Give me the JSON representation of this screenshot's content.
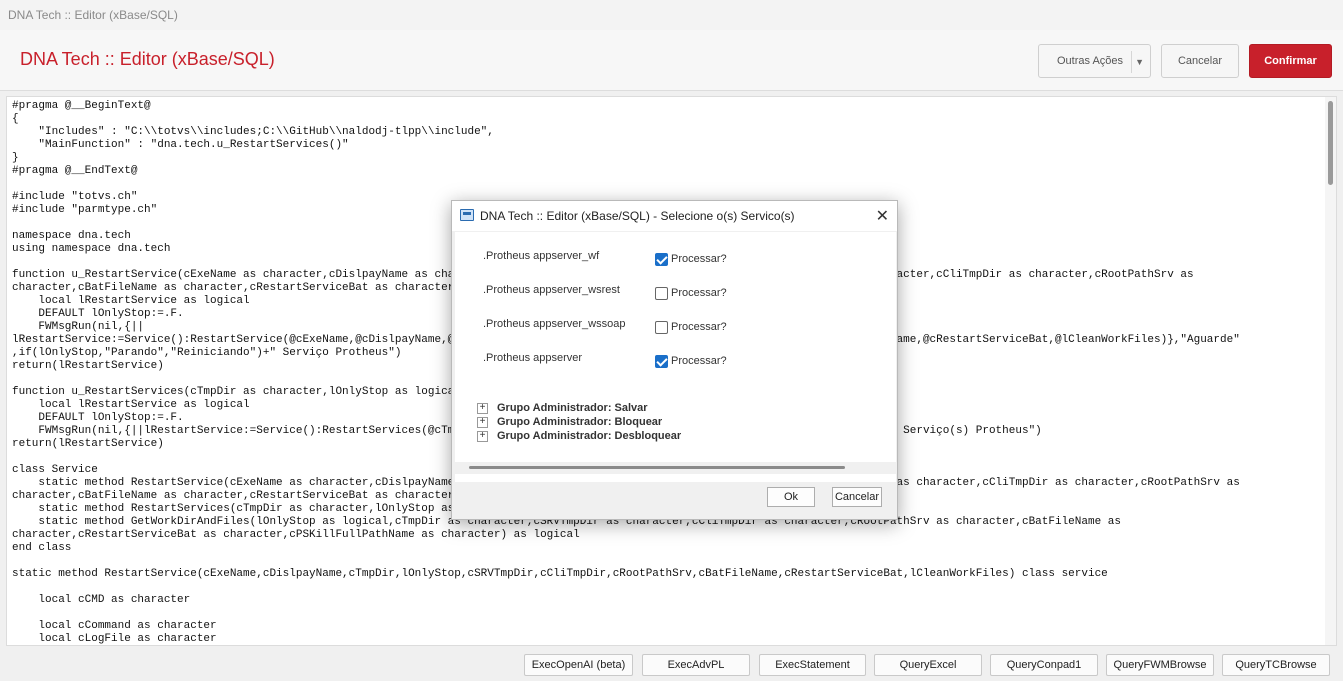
{
  "window": {
    "title": "DNA Tech :: Editor (xBase/SQL)"
  },
  "header": {
    "title": "DNA Tech :: Editor (xBase/SQL)",
    "outras_acoes": "Outras Ações",
    "cancelar": "Cancelar",
    "confirmar": "Confirmar",
    "accent_color": "#c8202b"
  },
  "editor": {
    "code": "#pragma @__BeginText@\n{\n    \"Includes\" : \"C:\\\\totvs\\\\includes;C:\\\\GitHub\\\\naldodj-tlpp\\\\include\",\n    \"MainFunction\" : \"dna.tech.u_RestartServices()\"\n}\n#pragma @__EndText@\n\n#include \"totvs.ch\"\n#include \"parmtype.ch\"\n\nnamespace dna.tech\nusing namespace dna.tech\n\nfunction u_RestartService(cExeName as character,cDislpayName as character,cTmpDir as character,lOnlyStop as logical,cSRVTmpDir as character,cCliTmpDir as character,cRootPathSrv as\ncharacter,cBatFileName as character,cRestartServiceBat as character,lCleanWorkFiles as logical)\n    local lRestartService as logical\n    DEFAULT lOnlyStop:=.F.\n    FWMsgRun(nil,{||\nlRestartService:=Service():RestartService(@cExeName,@cDislpayName,@cTmpDir,@lOnlyStop,@cSRVTmpDir,@cCliTmpDir,@cRootPathSrv,@cBatFileName,@cRestartServiceBat,@lCleanWorkFiles)},\"Aguarde\"\n,if(lOnlyStop,\"Parando\",\"Reiniciando\")+\" Serviço Protheus\")\nreturn(lRestartService)\n\nfunction u_RestartServices(cTmpDir as character,lOnlyStop as logical)\n    local lRestartService as logical\n    DEFAULT lOnlyStop:=.F.\n    FWMsgRun(nil,{||lRestartService:=Service():RestartServices(@cTmpDir,@lOnlyStop)},\"Aguarde\",if(lOnlyStop,\"Parando\",\"Reiniciando\")+\" Serviço(s) Protheus\")\nreturn(lRestartService)\n\nclass Service\n    static method RestartService(cExeName as character,cDislpayName as character,cTmpDir as character,lOnlyStop as logical,cSRVTmpDir as character,cCliTmpDir as character,cRootPathSrv as\ncharacter,cBatFileName as character,cRestartServiceBat as character,lCleanWorkFiles as logical) as logical\n    static method RestartServices(cTmpDir as character,lOnlyStop as logical) as logical\n    static method GetWorkDirAndFiles(lOnlyStop as logical,cTmpDir as character,cSRVTmpDir as character,cCliTmpDir as character,cRootPathSrv as character,cBatFileName as\ncharacter,cRestartServiceBat as character,cPSKillFullPathName as character) as logical\nend class\n\nstatic method RestartService(cExeName,cDislpayName,cTmpDir,lOnlyStop,cSRVTmpDir,cCliTmpDir,cRootPathSrv,cBatFileName,cRestartServiceBat,lCleanWorkFiles) class service\n\n    local cCMD as character\n\n    local cCommand as character\n    local cLogFile as character"
  },
  "dialog": {
    "title": "DNA Tech :: Editor (xBase/SQL) - Selecione o(s) Servico(s)",
    "services": [
      {
        "name": ".Protheus appserver_wf",
        "label": "Processar?",
        "checked": true
      },
      {
        "name": ".Protheus appserver_wsrest",
        "label": "Processar?",
        "checked": false
      },
      {
        "name": ".Protheus appserver_wssoap",
        "label": "Processar?",
        "checked": false
      },
      {
        "name": ".Protheus appserver",
        "label": "Processar?",
        "checked": true
      }
    ],
    "groups": [
      "Grupo Administrador: Salvar",
      "Grupo Administrador: Bloquear",
      "Grupo Administrador: Desbloquear"
    ],
    "ok": "Ok",
    "cancelar": "Cancelar"
  },
  "footer": {
    "buttons": [
      "ExecOpenAI (beta)",
      "ExecAdvPL",
      "ExecStatement",
      "QueryExcel",
      "QueryConpad1",
      "QueryFWMBrowse",
      "QueryTCBrowse"
    ]
  }
}
